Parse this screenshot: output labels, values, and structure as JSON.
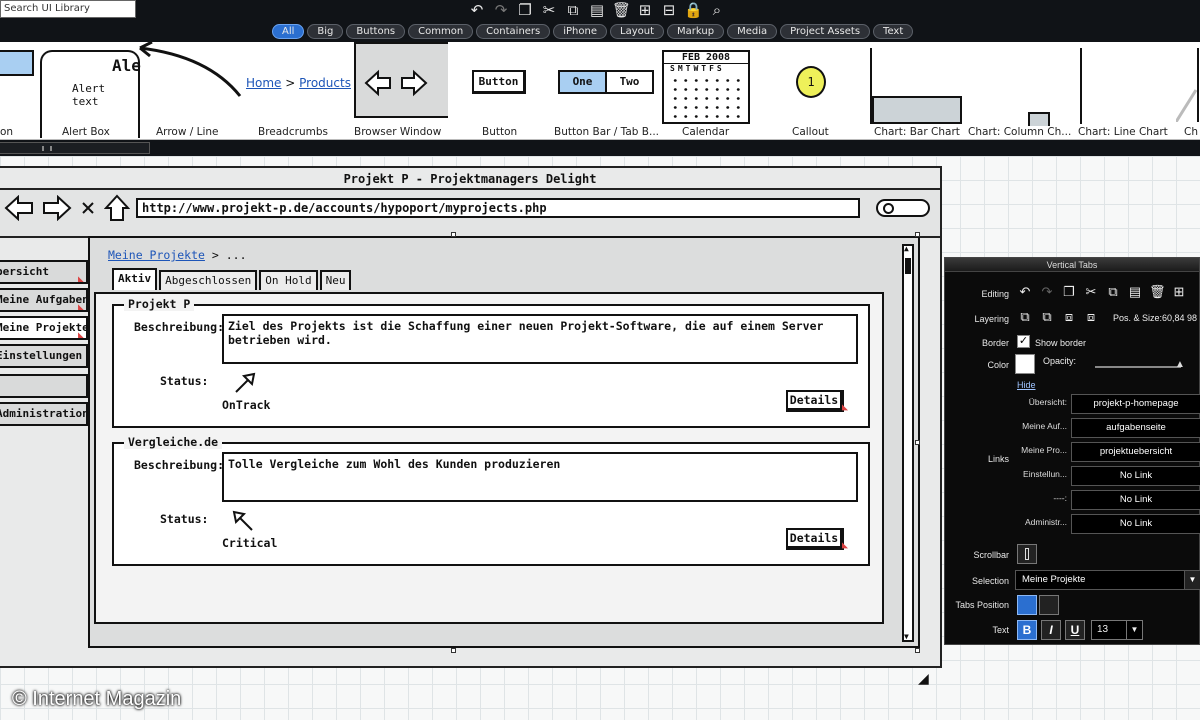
{
  "search": {
    "placeholder": "Search UI Library"
  },
  "filters": [
    "All",
    "Big",
    "Buttons",
    "Common",
    "Containers",
    "iPhone",
    "Layout",
    "Markup",
    "Media",
    "Project Assets",
    "Text"
  ],
  "filters_active": "All",
  "toolbar_icons": [
    "undo-icon",
    "redo-icon",
    "copy-icon",
    "cut-icon",
    "duplicate-icon",
    "paste-icon",
    "delete-icon",
    "group-icon",
    "ungroup-icon",
    "lock-icon",
    "search-icon"
  ],
  "library": {
    "items": [
      {
        "label": "on",
        "name": "lib-partial"
      },
      {
        "label": "Alert Box",
        "name": "lib-alert-box",
        "preview_title": "Ale",
        "preview_text": "Alert text"
      },
      {
        "label": "Arrow / Line",
        "name": "lib-arrow-line"
      },
      {
        "label": "Breadcrumbs",
        "name": "lib-breadcrumbs",
        "preview_home": "Home",
        "preview_products": "Products"
      },
      {
        "label": "Browser Window",
        "name": "lib-browser-window"
      },
      {
        "label": "Button",
        "name": "lib-button",
        "preview": "Button"
      },
      {
        "label": "Button Bar / Tab B...",
        "name": "lib-button-bar",
        "preview_one": "One",
        "preview_two": "Two"
      },
      {
        "label": "Calendar",
        "name": "lib-calendar",
        "preview_month": "FEB 2008",
        "preview_days": "SMTWTFS"
      },
      {
        "label": "Callout",
        "name": "lib-callout",
        "preview": "1"
      },
      {
        "label": "Chart: Bar Chart",
        "name": "lib-chart-bar"
      },
      {
        "label": "Chart: Column Ch...",
        "name": "lib-chart-column"
      },
      {
        "label": "Chart: Line Chart",
        "name": "lib-chart-line"
      },
      {
        "label": "Ch",
        "name": "lib-chart-partial"
      }
    ]
  },
  "browser": {
    "title": "Projekt P - Projektmanagers Delight",
    "url": "http://www.projekt-p.de/accounts/hypoport/myprojects.php"
  },
  "side_nav": [
    "bersicht",
    "Meine Aufgaben",
    "Meine Projekte",
    "Einstellungen",
    "",
    "Administration"
  ],
  "breadcrumb": {
    "link": "Meine Projekte",
    "separator": ">",
    "rest": "..."
  },
  "tabs": [
    "Aktiv",
    "Abgeschlossen",
    "On Hold",
    "Neu"
  ],
  "projects": [
    {
      "title": "Projekt P",
      "desc_label": "Beschreibung:",
      "description": "Ziel des Projekts ist die Schaffung einer neuen Projekt-Software, die auf einem Server betrieben wird.",
      "status_label": "Status:",
      "status": "OnTrack",
      "status_icon": "arrow-up-right-icon",
      "details": "Details"
    },
    {
      "title": "Vergleiche.de",
      "desc_label": "Beschreibung:",
      "description": "Tolle Vergleiche zum Wohl des Kunden produzieren",
      "status_label": "Status:",
      "status": "Critical",
      "status_icon": "arrow-up-left-icon",
      "details": "Details"
    }
  ],
  "watermark": "© Internet Magazin",
  "inspector": {
    "title": "Vertical Tabs",
    "editing_label": "Editing",
    "layering_label": "Layering",
    "pos_size": "Pos. & Size:60,84 98",
    "border_label": "Border",
    "show_border": "Show border",
    "color_label": "Color",
    "opacity_label": "Opacity:",
    "opacity_value": 1.0,
    "hide": "Hide",
    "links_label": "Links",
    "links": [
      {
        "name": "Übersicht:",
        "target": "projekt-p-homepage"
      },
      {
        "name": "Meine Auf...",
        "target": "aufgabenseite"
      },
      {
        "name": "Meine Pro...",
        "target": "projektuebersicht"
      },
      {
        "name": "Einstellun...",
        "target": "No Link"
      },
      {
        "name": "----:",
        "target": "No Link"
      },
      {
        "name": "Administr...",
        "target": "No Link"
      }
    ],
    "scrollbar_label": "Scrollbar",
    "selection_label": "Selection",
    "selection_value": "Meine Projekte",
    "tabs_position_label": "Tabs Position",
    "text_label": "Text",
    "bold": "B",
    "italic": "I",
    "underline": "U",
    "font_size": "13"
  }
}
